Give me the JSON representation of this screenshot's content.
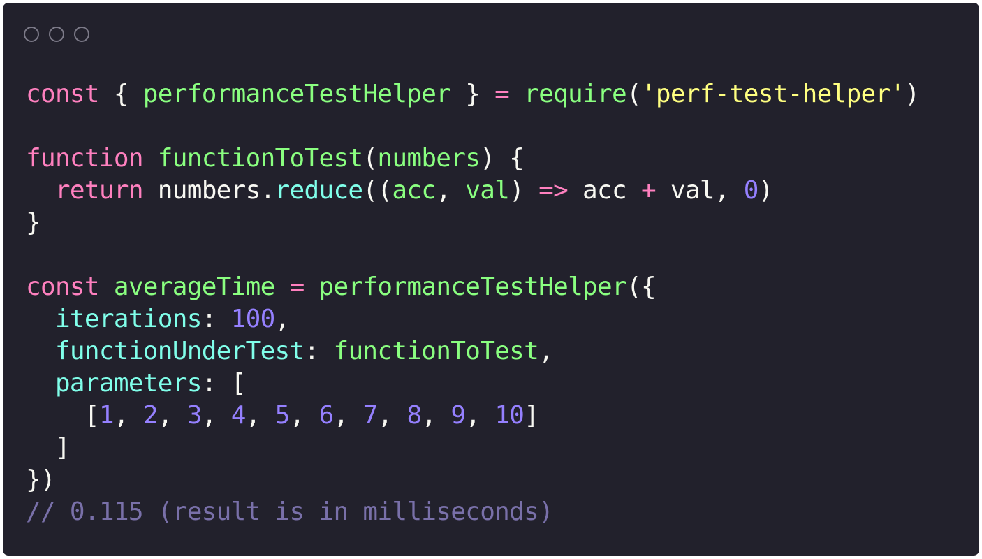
{
  "window": {
    "controls": [
      "close",
      "minimize",
      "maximize"
    ],
    "background": "#22212c"
  },
  "colors": {
    "keyword": "#ff80bf",
    "function": "#8aff80",
    "property": "#80ffea",
    "string": "#ffff80",
    "number": "#9580ff",
    "text": "#f8f8f2",
    "comment": "#7970a9"
  },
  "code": {
    "lines": [
      [
        [
          "keyword",
          "const"
        ],
        [
          "plain",
          " { "
        ],
        [
          "name",
          "performanceTestHelper"
        ],
        [
          "plain",
          " } "
        ],
        [
          "op",
          "="
        ],
        [
          "plain",
          " "
        ],
        [
          "name",
          "require"
        ],
        [
          "plain",
          "("
        ],
        [
          "string",
          "'perf-test-helper'"
        ],
        [
          "plain",
          ")"
        ]
      ],
      [],
      [
        [
          "keyword",
          "function"
        ],
        [
          "plain",
          " "
        ],
        [
          "name",
          "functionToTest"
        ],
        [
          "plain",
          "("
        ],
        [
          "param",
          "numbers"
        ],
        [
          "plain",
          ") {"
        ]
      ],
      [
        [
          "plain",
          "  "
        ],
        [
          "keyword",
          "return"
        ],
        [
          "plain",
          " numbers."
        ],
        [
          "method",
          "reduce"
        ],
        [
          "plain",
          "(("
        ],
        [
          "param",
          "acc"
        ],
        [
          "plain",
          ", "
        ],
        [
          "param",
          "val"
        ],
        [
          "plain",
          ") "
        ],
        [
          "op",
          "=>"
        ],
        [
          "plain",
          " acc "
        ],
        [
          "op",
          "+"
        ],
        [
          "plain",
          " val, "
        ],
        [
          "number",
          "0"
        ],
        [
          "plain",
          ")"
        ]
      ],
      [
        [
          "plain",
          "}"
        ]
      ],
      [],
      [
        [
          "keyword",
          "const"
        ],
        [
          "plain",
          " "
        ],
        [
          "name",
          "averageTime"
        ],
        [
          "plain",
          " "
        ],
        [
          "op",
          "="
        ],
        [
          "plain",
          " "
        ],
        [
          "name",
          "performanceTestHelper"
        ],
        [
          "plain",
          "({"
        ]
      ],
      [
        [
          "plain",
          "  "
        ],
        [
          "prop",
          "iterations"
        ],
        [
          "plain",
          ": "
        ],
        [
          "number",
          "100"
        ],
        [
          "plain",
          ","
        ]
      ],
      [
        [
          "plain",
          "  "
        ],
        [
          "prop",
          "functionUnderTest"
        ],
        [
          "plain",
          ": "
        ],
        [
          "name",
          "functionToTest"
        ],
        [
          "plain",
          ","
        ]
      ],
      [
        [
          "plain",
          "  "
        ],
        [
          "prop",
          "parameters"
        ],
        [
          "plain",
          ": ["
        ]
      ],
      [
        [
          "plain",
          "    ["
        ],
        [
          "number",
          "1"
        ],
        [
          "plain",
          ", "
        ],
        [
          "number",
          "2"
        ],
        [
          "plain",
          ", "
        ],
        [
          "number",
          "3"
        ],
        [
          "plain",
          ", "
        ],
        [
          "number",
          "4"
        ],
        [
          "plain",
          ", "
        ],
        [
          "number",
          "5"
        ],
        [
          "plain",
          ", "
        ],
        [
          "number",
          "6"
        ],
        [
          "plain",
          ", "
        ],
        [
          "number",
          "7"
        ],
        [
          "plain",
          ", "
        ],
        [
          "number",
          "8"
        ],
        [
          "plain",
          ", "
        ],
        [
          "number",
          "9"
        ],
        [
          "plain",
          ", "
        ],
        [
          "number",
          "10"
        ],
        [
          "plain",
          "]"
        ]
      ],
      [
        [
          "plain",
          "  ]"
        ]
      ],
      [
        [
          "plain",
          "})"
        ]
      ],
      [
        [
          "comment",
          "// 0.115 (result is in milliseconds)"
        ]
      ]
    ]
  }
}
